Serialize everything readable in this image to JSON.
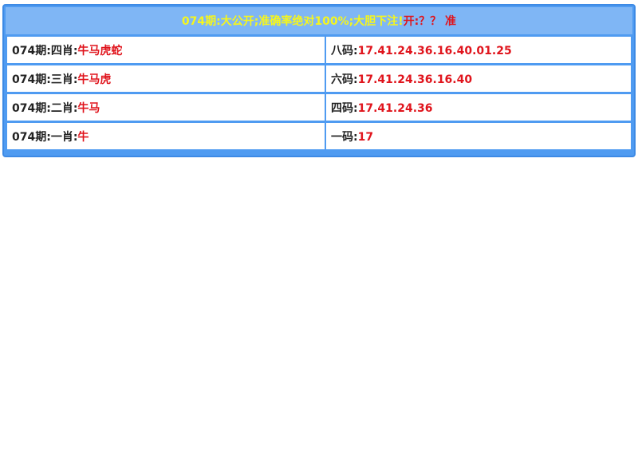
{
  "banner": {
    "text_yellow": "074期:大公开;准确率绝对100%;大胆下注!",
    "text_red": "开:？？ 准"
  },
  "rows": [
    {
      "left_label": "074期:四肖:",
      "left_value": "牛马虎蛇",
      "right_label": "八码:",
      "right_value": "17.41.24.36.16.40.01.25"
    },
    {
      "left_label": "074期:三肖:",
      "left_value": "牛马虎",
      "right_label": "六码:",
      "right_value": "17.41.24.36.16.40"
    },
    {
      "left_label": "074期:二肖:",
      "left_value": "牛马",
      "right_label": "四码:",
      "right_value": "17.41.24.36"
    },
    {
      "left_label": "074期:一肖:",
      "left_value": "牛",
      "right_label": "一码:",
      "right_value": "17"
    }
  ],
  "colors": {
    "panel_bg": "#4f9bf1",
    "banner_bg": "#7fb6f5",
    "highlight_yellow": "#f6f61c",
    "value_red": "#e0141c"
  }
}
